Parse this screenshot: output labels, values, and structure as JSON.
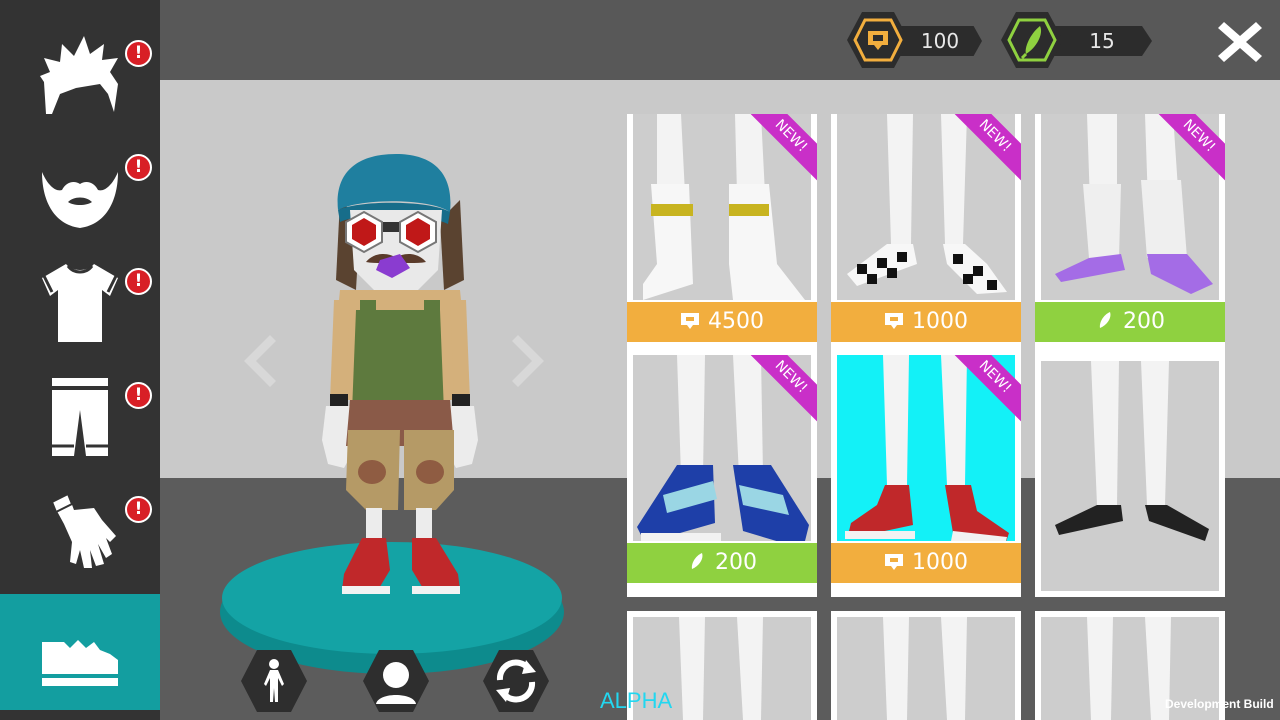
{
  "currency": {
    "coins": {
      "icon": "coin-ticket-icon",
      "value": "100"
    },
    "gems": {
      "icon": "green-feather-gem-icon",
      "value": "15"
    }
  },
  "sidebar": {
    "categories": [
      {
        "name": "hair",
        "icon": "spiky-hair-icon",
        "alert": "!",
        "active": false
      },
      {
        "name": "beard",
        "icon": "beard-mustache-icon",
        "alert": "!",
        "active": false
      },
      {
        "name": "shirt",
        "icon": "tshirt-icon",
        "alert": "!",
        "active": false
      },
      {
        "name": "pants",
        "icon": "shorts-icon",
        "alert": "!",
        "active": false
      },
      {
        "name": "gloves",
        "icon": "glove-icon",
        "alert": "!",
        "active": false
      },
      {
        "name": "shoes",
        "icon": "sneaker-icon",
        "alert": "",
        "active": true
      }
    ]
  },
  "items": [
    {
      "ribbon": "NEW!",
      "price": "4500",
      "currency": "coin",
      "shoe": "white boots with yellow stripe"
    },
    {
      "ribbon": "NEW!",
      "price": "1000",
      "currency": "coin",
      "shoe": "black and white checkered slip-ons"
    },
    {
      "ribbon": "NEW!",
      "price": "200",
      "currency": "gem",
      "shoe": "purple shoes"
    },
    {
      "ribbon": "NEW!",
      "price": "200",
      "currency": "gem",
      "shoe": "blue strapped sneakers"
    },
    {
      "ribbon": "NEW!",
      "price": "1000",
      "currency": "coin",
      "shoe": "red high-top sneakers",
      "selected": true
    },
    {
      "ribbon": "",
      "price": "",
      "currency": "",
      "shoe": "black slip-ons"
    },
    {
      "ribbon": "",
      "price": "",
      "currency": "",
      "shoe": ""
    },
    {
      "ribbon": "",
      "price": "",
      "currency": "",
      "shoe": ""
    },
    {
      "ribbon": "",
      "price": "",
      "currency": "",
      "shoe": ""
    }
  ],
  "footer": {
    "alpha": "ALPHA",
    "dev_build": "Development Build"
  },
  "colors": {
    "accent_teal": "#139ea0",
    "price_gold": "#f2ae3e",
    "price_green": "#8fd140",
    "ribbon_magenta": "#c92fc8",
    "alert_red": "#d81f26",
    "selected_bg": "#13f1f7"
  }
}
